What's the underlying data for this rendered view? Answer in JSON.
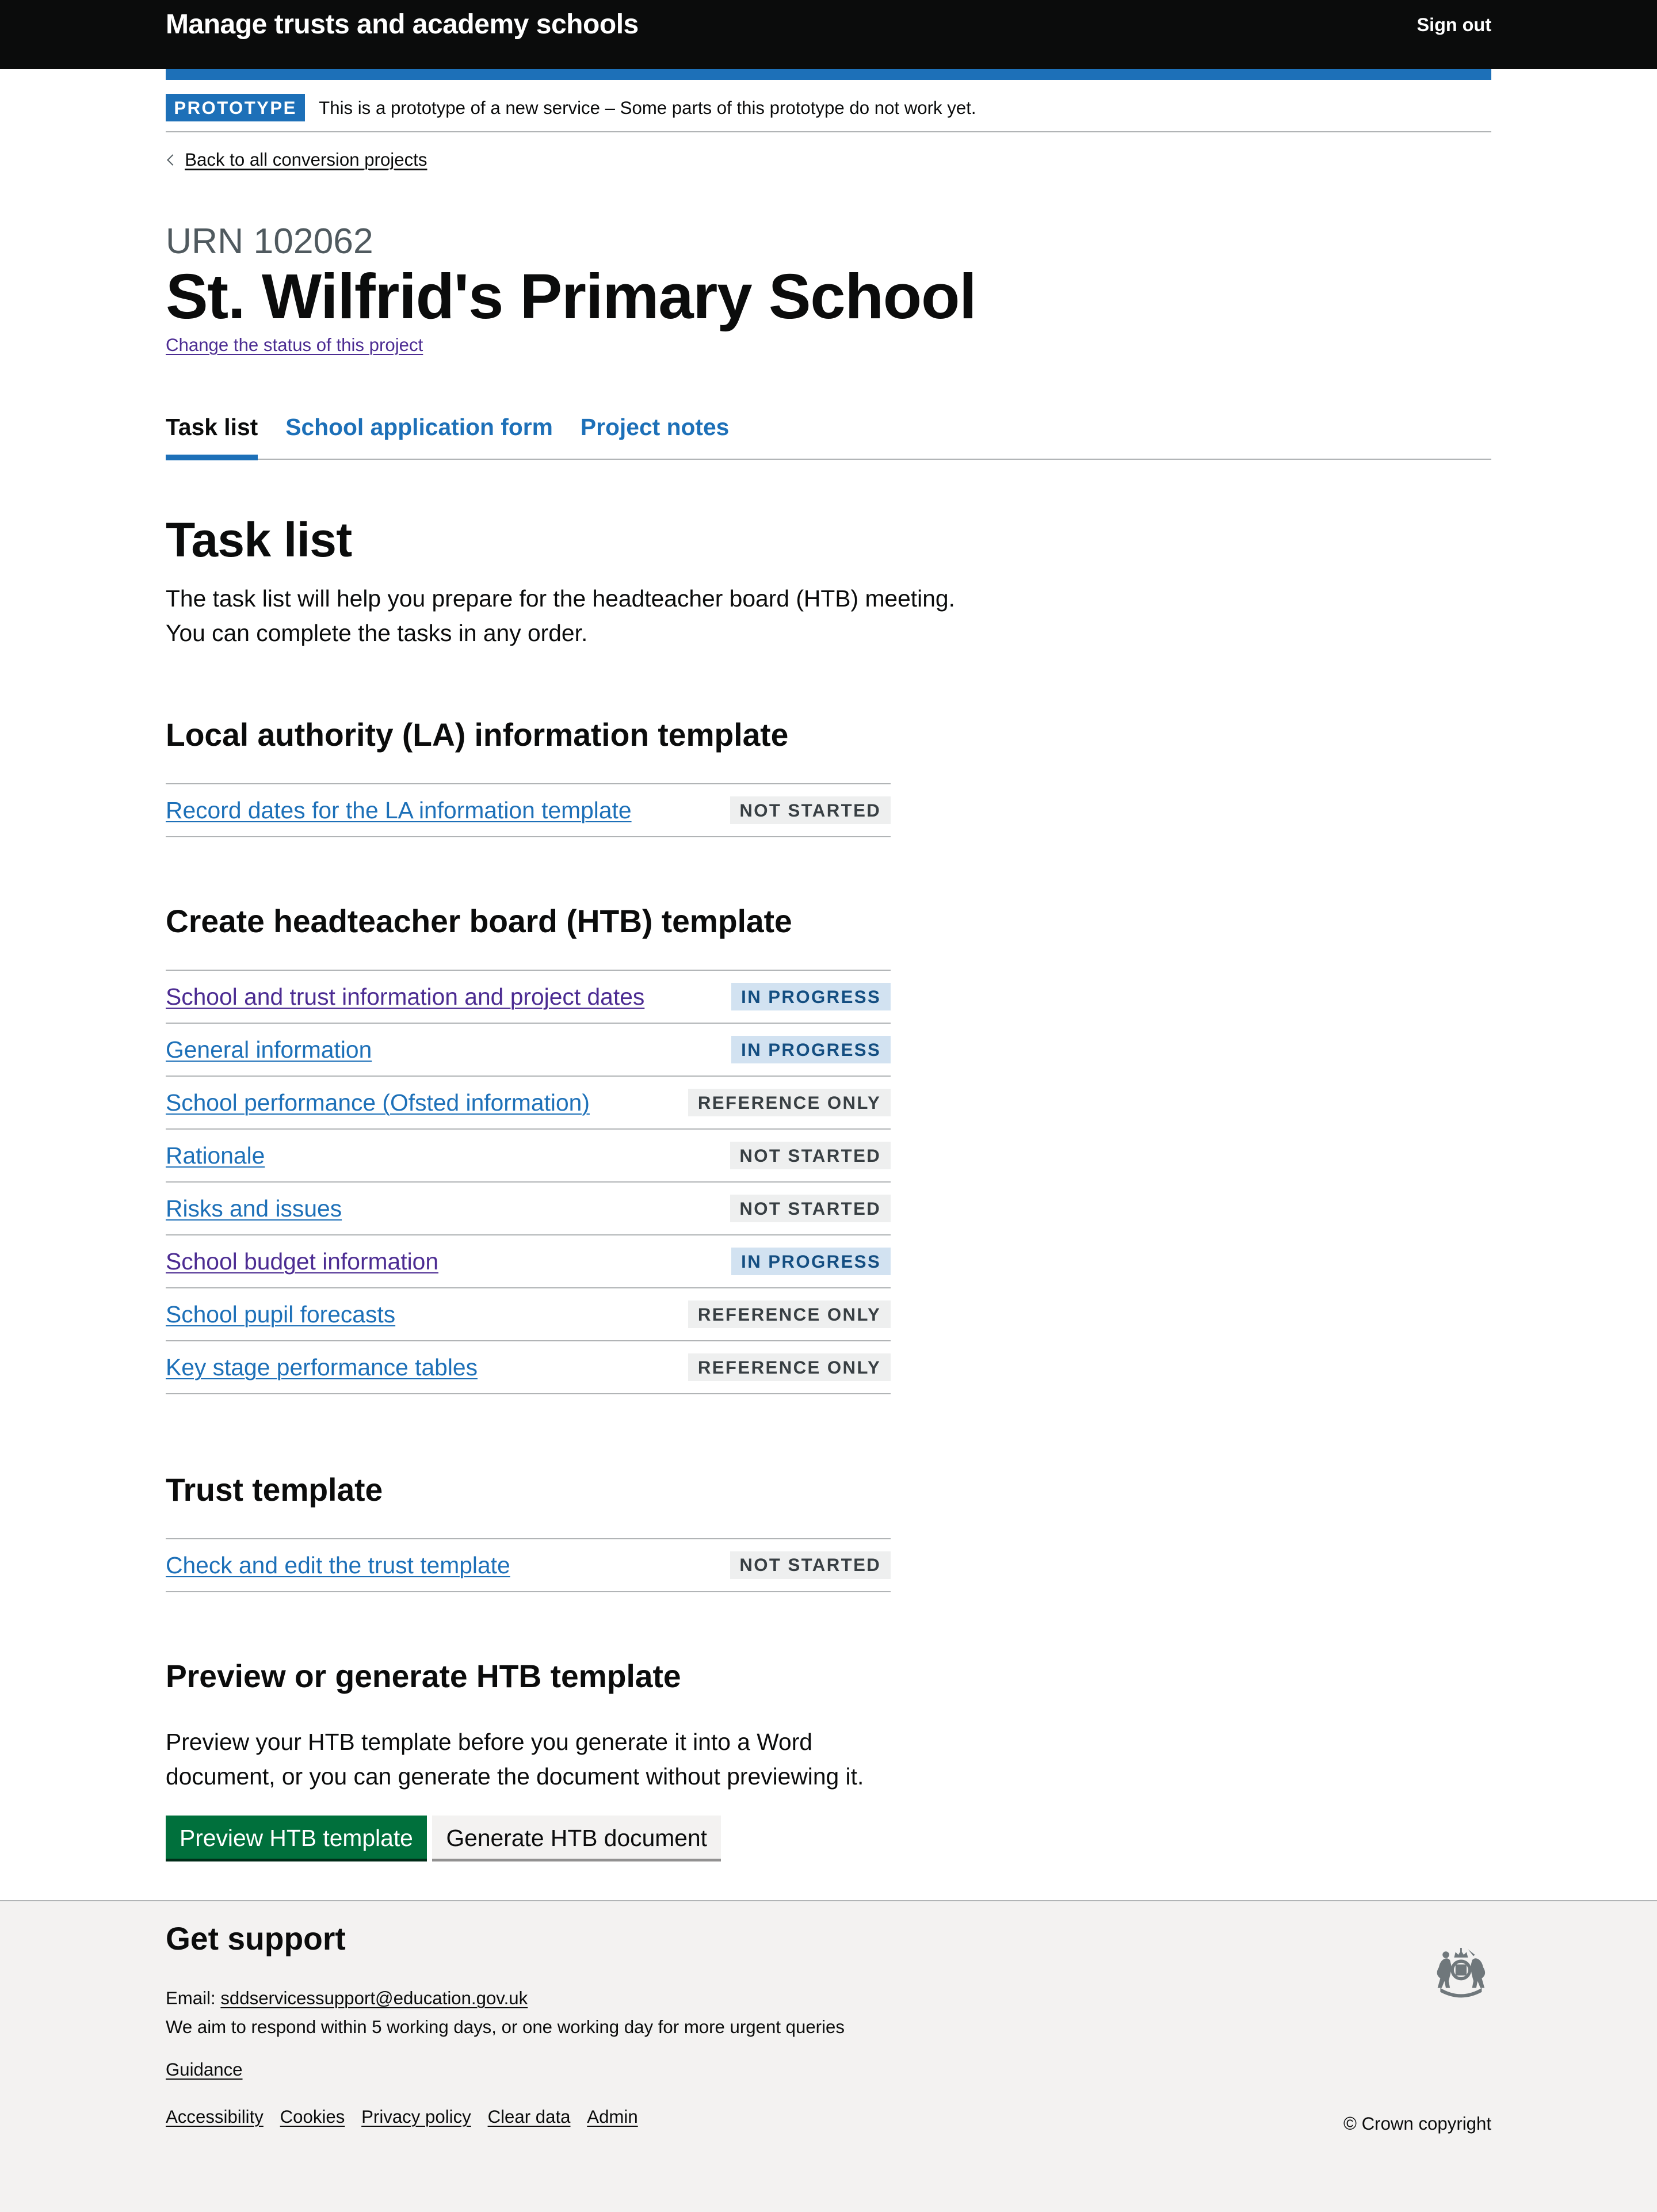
{
  "header": {
    "service_name": "Manage trusts and academy schools",
    "sign_out_label": "Sign out"
  },
  "phase_banner": {
    "tag": "PROTOTYPE",
    "text": "This is a prototype of a new service – Some parts of this prototype do not work yet."
  },
  "back_link": {
    "label": "Back to all conversion projects",
    "icon": "chevron-left-icon"
  },
  "project": {
    "caption": "URN 102062",
    "title": "St. Wilfrid's Primary School",
    "change_status_label": "Change the status of this project"
  },
  "tabs": [
    {
      "label": "Task list",
      "active": true
    },
    {
      "label": "School application form",
      "active": false
    },
    {
      "label": "Project notes",
      "active": false
    }
  ],
  "main": {
    "title": "Task list",
    "intro_line1": "The task list will help you prepare for the headteacher board (HTB) meeting.",
    "intro_line2": "You can complete the tasks in any order."
  },
  "sections": {
    "la": {
      "title": "Local authority (LA) information template",
      "tasks": [
        {
          "label": "Record dates for the LA information template",
          "status": "NOT STARTED",
          "visited": false
        }
      ]
    },
    "htb": {
      "title": "Create headteacher board (HTB) template",
      "tasks": [
        {
          "label": "School and trust information and project dates",
          "status": "IN PROGRESS",
          "visited": true
        },
        {
          "label": "General information",
          "status": "IN PROGRESS",
          "visited": false
        },
        {
          "label": "School performance (Ofsted information)",
          "status": "REFERENCE ONLY",
          "visited": false
        },
        {
          "label": "Rationale",
          "status": "NOT STARTED",
          "visited": false
        },
        {
          "label": "Risks and issues",
          "status": "NOT STARTED",
          "visited": false
        },
        {
          "label": "School budget information",
          "status": "IN PROGRESS",
          "visited": true
        },
        {
          "label": "School pupil forecasts",
          "status": "REFERENCE ONLY",
          "visited": false
        },
        {
          "label": "Key stage performance tables",
          "status": "REFERENCE ONLY",
          "visited": false
        }
      ]
    },
    "trust": {
      "title": "Trust template",
      "tasks": [
        {
          "label": "Check and edit the trust template",
          "status": "NOT STARTED",
          "visited": false
        }
      ]
    },
    "preview": {
      "title": "Preview or generate HTB template",
      "text": "Preview your HTB template before you generate it into a Word document, or you can generate the document without previewing it.",
      "primary_button": "Preview HTB template",
      "secondary_button": "Generate HTB document"
    }
  },
  "footer": {
    "heading": "Get support",
    "email_prefix": "Email: ",
    "email": "sddservicessupport@education.gov.uk",
    "response_note": "We aim to respond within 5 working days, or one working day for more urgent queries",
    "guidance_label": "Guidance",
    "links": [
      "Accessibility",
      "Cookies",
      "Privacy policy",
      "Clear data",
      "Admin"
    ],
    "crest_icon": "royal-coat-of-arms-icon",
    "copyright": "© Crown copyright"
  },
  "colors": {
    "header_bg": "#0b0c0c",
    "brand_blue": "#1d70b8",
    "link_visited": "#4c2c92",
    "button_green": "#00703c",
    "badge_grey_bg": "#eeefef",
    "badge_blue_bg": "#d2e2f1",
    "footer_bg": "#f3f2f1"
  }
}
